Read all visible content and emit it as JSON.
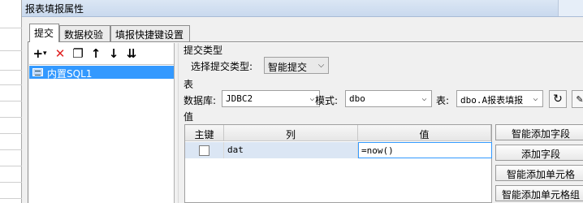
{
  "window": {
    "title": "报表填报属性"
  },
  "tabs": [
    {
      "label": "提交"
    },
    {
      "label": "数据校验"
    },
    {
      "label": "填报快捷键设置"
    }
  ],
  "toolbar": {
    "icons": [
      "add-icon",
      "delete-icon",
      "copy-icon",
      "move-up-icon",
      "move-down-icon",
      "move-bottom-icon"
    ],
    "glyphs": {
      "add": "+",
      "add_caret": "▾",
      "delete": "✕",
      "copy": "❐",
      "up": "↑",
      "down": "↓",
      "bottom": "⇊"
    }
  },
  "tree": {
    "items": [
      {
        "label": "内置SQL1"
      }
    ]
  },
  "submit_type": {
    "section_label": "提交类型",
    "select_label": "选择提交类型:",
    "value": "智能提交"
  },
  "table_section": {
    "section_label": "表",
    "database_label": "数据库:",
    "database_value": "JDBC2",
    "schema_label": "模式:",
    "schema_value": "dbo",
    "table_label": "表:",
    "table_value": "dbo.A报表填报"
  },
  "value_section": {
    "section_label": "值",
    "columns": [
      "主键",
      "列",
      "值"
    ],
    "rows": [
      {
        "primary_key": false,
        "column": "dat",
        "value": "=now()"
      }
    ]
  },
  "side_buttons": [
    "智能添加字段",
    "添加字段",
    "智能添加单元格",
    "智能添加单元格组"
  ],
  "colors": {
    "selection": "#3399ff",
    "row_highlight": "#dbe6f4",
    "titlebar": "#c9d9ee"
  }
}
